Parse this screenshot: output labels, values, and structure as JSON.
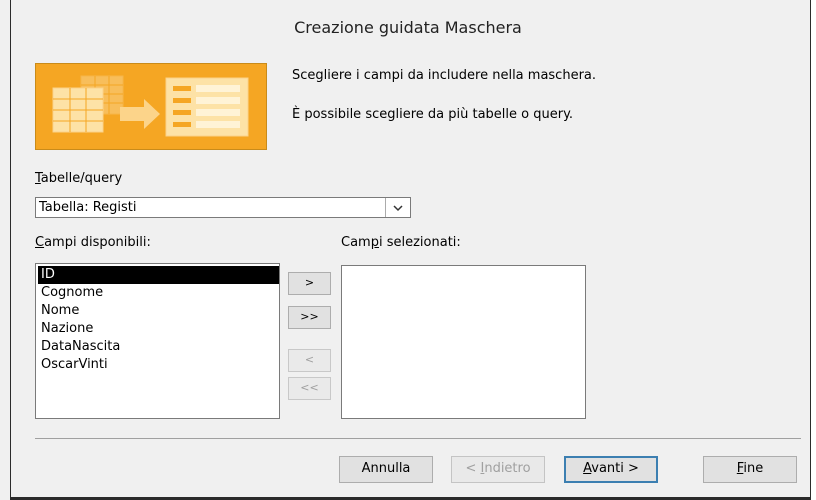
{
  "window": {
    "title": "Creazione guidata Maschera"
  },
  "instructions": {
    "line1": "Scegliere i campi da includere nella maschera.",
    "line2": "È possibile scegliere da più tabelle o query."
  },
  "table_query": {
    "label_accel": "T",
    "label_rest": "abelle/query",
    "selected_value": "Tabella: Registi"
  },
  "available_fields": {
    "label_accel": "C",
    "label_rest": "ampi disponibili:",
    "items": [
      "ID",
      "Cognome",
      "Nome",
      "Nazione",
      "DataNascita",
      "OscarVinti"
    ],
    "selected_index": 0
  },
  "selected_fields": {
    "label_before": "Cam",
    "label_accel": "p",
    "label_after": "i selezionati:",
    "items": []
  },
  "move_buttons": {
    "add_one": ">",
    "add_all": ">>",
    "remove_one": "<",
    "remove_all": "<<"
  },
  "footer": {
    "cancel": "Annulla",
    "back_prefix": "< ",
    "back_accel": "I",
    "back_rest": "ndietro",
    "next_accel": "A",
    "next_rest": "vanti >",
    "finish_accel": "F",
    "finish_rest": "ine"
  },
  "colors": {
    "illustration_orange": "#f39b1f",
    "default_button_border": "#3c7fb1",
    "selection_background": "#000000"
  }
}
